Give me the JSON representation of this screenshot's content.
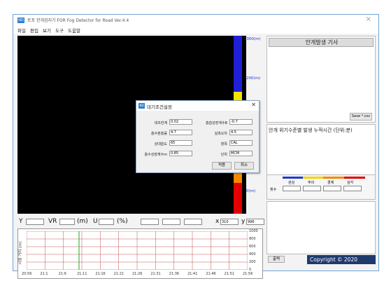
{
  "window": {
    "title": "토포 한개검지기 FOR Fog Detector for Road Ver.4.4",
    "close_glyph": "×",
    "app_icon_text": "ND"
  },
  "menu": [
    "파일",
    "편집",
    "보기",
    "도구",
    "도움말"
  ],
  "scale": {
    "labels": [
      "1000(m)",
      "200(m)",
      "0(m)"
    ]
  },
  "right_panel": {
    "header_title": "안개발생 기사",
    "save_button": "Save *.csv",
    "stats_title": "안개 위기수준별 발생 누적시간 (단위:분)",
    "levels": [
      "관심",
      "주의",
      "경계",
      "심각"
    ],
    "level_colors": [
      "#1f3bd1",
      "#f2d200",
      "#f08a00",
      "#e10000"
    ],
    "count_label": "횟수",
    "bottom_button": "출력",
    "copyright": "Copyright © 2020"
  },
  "status": {
    "y_label": "Y",
    "vr_label": "VR",
    "m_label": "(m)",
    "u_label": "U",
    "pct_label": "(%)",
    "x_label": "x",
    "x_value": "310",
    "y2_label": "y",
    "y2_value": "996"
  },
  "graph": {
    "axis_title": "시정 거리 (m)",
    "y_ticks": [
      "1000",
      "800",
      "600",
      "400",
      "200",
      "0"
    ],
    "x_ticks": [
      "20:56",
      "21:1",
      "21:6",
      "21:11",
      "21:16",
      "21:21",
      "21:26",
      "21:31",
      "21:36",
      "21:41",
      "21:46",
      "21:51",
      "21:56"
    ]
  },
  "dialog": {
    "title": "대기조건설정",
    "icon_text": "ND",
    "close_glyph": "✕",
    "fields_left": [
      {
        "label": "대조한계",
        "value": "0.02"
      },
      {
        "label": "흡수분흡률",
        "value": "4.7"
      },
      {
        "label": "상대습도",
        "value": "65"
      },
      {
        "label": "흡수성장계수m",
        "value": "0.85"
      }
    ],
    "fields_right": [
      {
        "label": "흡습성장계수B",
        "value": "-0.7"
      },
      {
        "label": "실측오차",
        "value": "4.5"
      },
      {
        "label": "항목",
        "value": "CAL"
      },
      {
        "label": "단위",
        "value": "MCM"
      }
    ],
    "apply_button": "적용",
    "cancel_button": "취소"
  }
}
